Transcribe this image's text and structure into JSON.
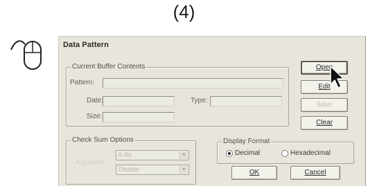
{
  "step_label": "(4)",
  "dialog": {
    "title": "Data Pattern",
    "current_buffer": {
      "group_label": "Current Buffer Contents",
      "pattern_label": "Pattern:",
      "date_label": "Date:",
      "type_label": "Type:",
      "size_label": "Size:",
      "pattern_value": "",
      "date_value": "",
      "type_value": "",
      "size_value": ""
    },
    "buttons": {
      "open": "Open",
      "edit": "Edit",
      "save": "Save",
      "clear": "Clear",
      "ok": "OK",
      "cancel": "Cancel"
    },
    "checksum": {
      "group_label": "Check Sum Options",
      "hidden_label": "Algorithm",
      "select1_value": "8-Bit",
      "select2_value": "Disable"
    },
    "display_format": {
      "group_label": "Display Format",
      "options": [
        "Decimal",
        "Hexadecimal"
      ],
      "selected": "Decimal"
    }
  },
  "icons": {
    "mouse": "mouse-icon",
    "cursor": "mouse-pointer-icon"
  }
}
